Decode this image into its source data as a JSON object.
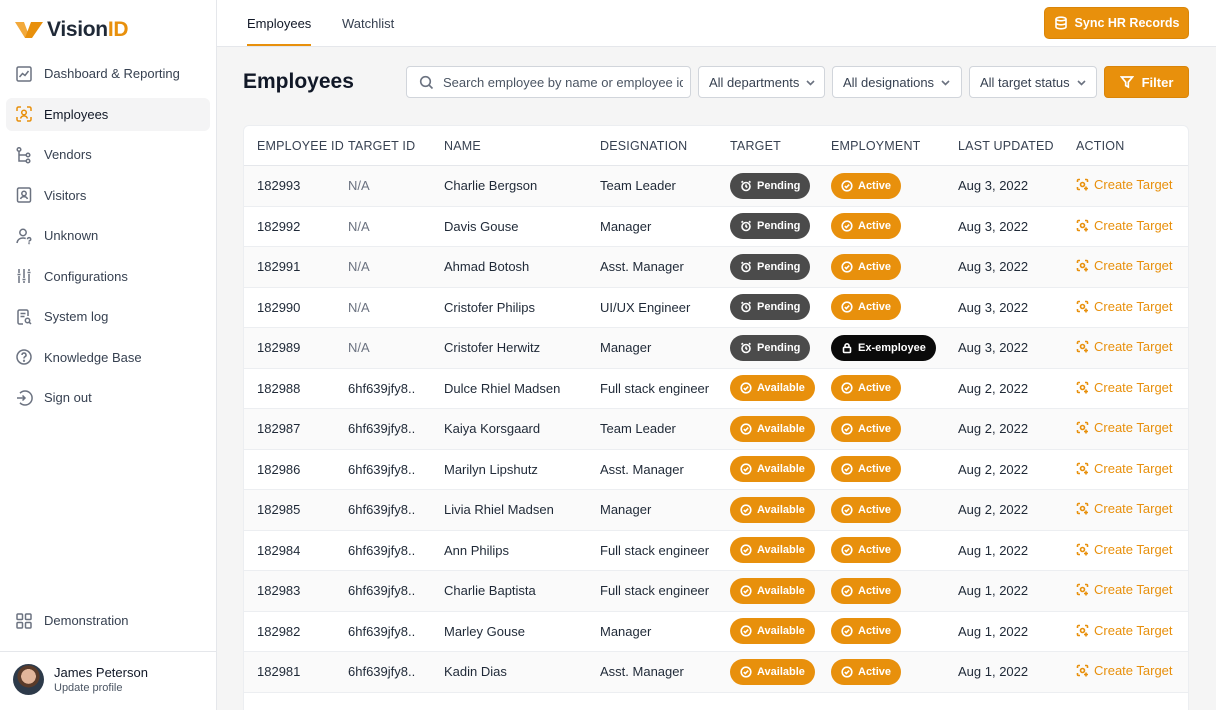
{
  "brand": {
    "name_part1": "Vision",
    "name_part2": "ID",
    "accent": "#e8900c"
  },
  "sidebar": {
    "items": [
      {
        "label": "Dashboard & Reporting",
        "icon": "chart-icon",
        "active": false
      },
      {
        "label": "Employees",
        "icon": "face-scan-icon",
        "active": true
      },
      {
        "label": "Vendors",
        "icon": "hierarchy-icon",
        "active": false
      },
      {
        "label": "Visitors",
        "icon": "id-badge-icon",
        "active": false
      },
      {
        "label": "Unknown",
        "icon": "user-question-icon",
        "active": false
      },
      {
        "label": "Configurations",
        "icon": "sliders-icon",
        "active": false
      },
      {
        "label": "System log",
        "icon": "log-document-icon",
        "active": false
      },
      {
        "label": "Knowledge Base",
        "icon": "help-circle-icon",
        "active": false
      },
      {
        "label": "Sign out",
        "icon": "sign-out-icon",
        "active": false
      }
    ],
    "demo_label": "Demonstration",
    "profile": {
      "name": "James Peterson",
      "sub": "Update profile"
    }
  },
  "topbar": {
    "tabs": [
      {
        "label": "Employees",
        "active": true
      },
      {
        "label": "Watchlist",
        "active": false
      }
    ],
    "sync_label": "Sync HR Records"
  },
  "header": {
    "title": "Employees",
    "search_placeholder": "Search employee by name or employee id",
    "filters": [
      "All departments",
      "All designations",
      "All target status"
    ],
    "filter_label": "Filter"
  },
  "table": {
    "columns": [
      "EMPLOYEE ID",
      "TARGET ID",
      "NAME",
      "DESIGNATION",
      "TARGET",
      "EMPLOYMENT",
      "LAST UPDATED",
      "ACTION"
    ],
    "action_label": "Create Target",
    "rows": [
      {
        "id": "182993",
        "target_id": "N/A",
        "name": "Charlie Bergson",
        "designation": "Team Leader",
        "target": "Pending",
        "employment": "Active",
        "updated": "Aug 3, 2022"
      },
      {
        "id": "182992",
        "target_id": "N/A",
        "name": "Davis Gouse",
        "designation": "Manager",
        "target": "Pending",
        "employment": "Active",
        "updated": "Aug 3, 2022"
      },
      {
        "id": "182991",
        "target_id": "N/A",
        "name": "Ahmad Botosh",
        "designation": "Asst. Manager",
        "target": "Pending",
        "employment": "Active",
        "updated": "Aug 3, 2022"
      },
      {
        "id": "182990",
        "target_id": "N/A",
        "name": "Cristofer Philips",
        "designation": "UI/UX Engineer",
        "target": "Pending",
        "employment": "Active",
        "updated": "Aug 3, 2022"
      },
      {
        "id": "182989",
        "target_id": "N/A",
        "name": "Cristofer Herwitz",
        "designation": "Manager",
        "target": "Pending",
        "employment": "Ex-employee",
        "updated": "Aug 3, 2022"
      },
      {
        "id": "182988",
        "target_id": "6hf639jfy8..",
        "name": "Dulce Rhiel Madsen",
        "designation": "Full stack engineer",
        "target": "Available",
        "employment": "Active",
        "updated": "Aug 2, 2022"
      },
      {
        "id": "182987",
        "target_id": "6hf639jfy8..",
        "name": "Kaiya Korsgaard",
        "designation": "Team Leader",
        "target": "Available",
        "employment": "Active",
        "updated": "Aug 2, 2022"
      },
      {
        "id": "182986",
        "target_id": "6hf639jfy8..",
        "name": "Marilyn Lipshutz",
        "designation": "Asst. Manager",
        "target": "Available",
        "employment": "Active",
        "updated": "Aug 2, 2022"
      },
      {
        "id": "182985",
        "target_id": "6hf639jfy8..",
        "name": "Livia Rhiel Madsen",
        "designation": "Manager",
        "target": "Available",
        "employment": "Active",
        "updated": "Aug 2, 2022"
      },
      {
        "id": "182984",
        "target_id": "6hf639jfy8..",
        "name": "Ann Philips",
        "designation": "Full stack engineer",
        "target": "Available",
        "employment": "Active",
        "updated": "Aug 1, 2022"
      },
      {
        "id": "182983",
        "target_id": "6hf639jfy8..",
        "name": "Charlie Baptista",
        "designation": "Full stack engineer",
        "target": "Available",
        "employment": "Active",
        "updated": "Aug 1, 2022"
      },
      {
        "id": "182982",
        "target_id": "6hf639jfy8..",
        "name": "Marley Gouse",
        "designation": "Manager",
        "target": "Available",
        "employment": "Active",
        "updated": "Aug 1, 2022"
      },
      {
        "id": "182981",
        "target_id": "6hf639jfy8..",
        "name": "Kadin Dias",
        "designation": "Asst. Manager",
        "target": "Available",
        "employment": "Active",
        "updated": "Aug 1, 2022"
      }
    ]
  }
}
